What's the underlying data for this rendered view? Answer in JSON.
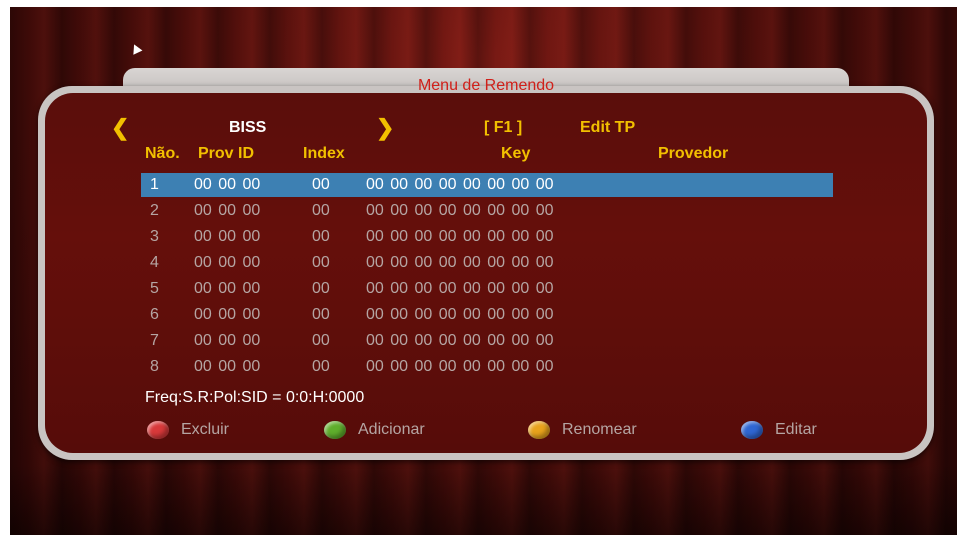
{
  "dialog": {
    "title": "Menu de Remendo",
    "mode_label": "BISS",
    "f1_label": "[ F1 ]",
    "edit_tp_label": "Edit TP"
  },
  "columns": {
    "no": "Não.",
    "prov_id": "Prov ID",
    "index": "Index",
    "key": "Key",
    "provider": "Provedor"
  },
  "rows": [
    {
      "no": "1",
      "prov_id": "00 00 00",
      "index": "00",
      "key": "00 00 00 00 00 00 00 00",
      "selected": true
    },
    {
      "no": "2",
      "prov_id": "00 00 00",
      "index": "00",
      "key": "00 00 00 00 00 00 00 00",
      "selected": false
    },
    {
      "no": "3",
      "prov_id": "00 00 00",
      "index": "00",
      "key": "00 00 00 00 00 00 00 00",
      "selected": false
    },
    {
      "no": "4",
      "prov_id": "00 00 00",
      "index": "00",
      "key": "00 00 00 00 00 00 00 00",
      "selected": false
    },
    {
      "no": "5",
      "prov_id": "00 00 00",
      "index": "00",
      "key": "00 00 00 00 00 00 00 00",
      "selected": false
    },
    {
      "no": "6",
      "prov_id": "00 00 00",
      "index": "00",
      "key": "00 00 00 00 00 00 00 00",
      "selected": false
    },
    {
      "no": "7",
      "prov_id": "00 00 00",
      "index": "00",
      "key": "00 00 00 00 00 00 00 00",
      "selected": false
    },
    {
      "no": "8",
      "prov_id": "00 00 00",
      "index": "00",
      "key": "00 00 00 00 00 00 00 00",
      "selected": false
    }
  ],
  "freq_line": "Freq:S.R:Pol:SID = 0:0:H:0000",
  "legend": [
    {
      "label": "Excluir",
      "color": "#d8393a",
      "icon": "red-ball-icon"
    },
    {
      "label": "Adicionar",
      "color": "#5fae2c",
      "icon": "green-ball-icon"
    },
    {
      "label": "Renomear",
      "color": "#e8a21c",
      "icon": "yellow-ball-icon"
    },
    {
      "label": "Editar",
      "color": "#2f66d2",
      "icon": "blue-ball-icon"
    }
  ],
  "colors": {
    "selection": "#3d80b3",
    "header_text": "#f2c000",
    "title_text": "#d0201a"
  }
}
